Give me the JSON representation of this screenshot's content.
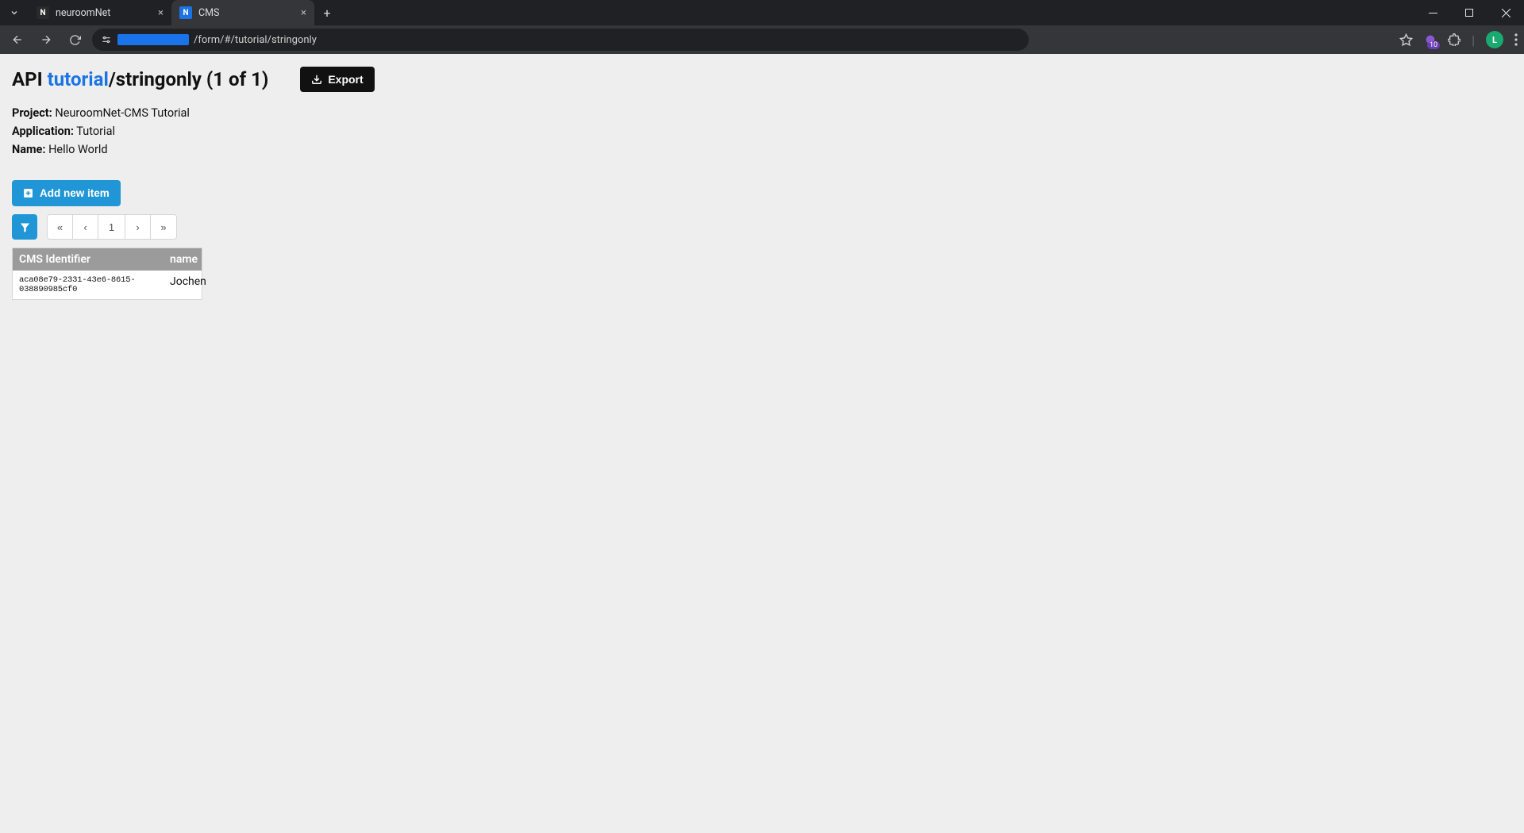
{
  "browser": {
    "tabs": [
      {
        "title": "neuroomNet",
        "active": false
      },
      {
        "title": "CMS",
        "active": true
      }
    ],
    "url_path": "/form/#/tutorial/stringonly",
    "ext_count": "10",
    "avatar_letter": "L"
  },
  "page": {
    "heading_prefix": "API ",
    "heading_link": "tutorial",
    "heading_suffix": "/stringonly (1 of 1)",
    "export_label": "Export",
    "meta": {
      "project_label": "Project:",
      "project_value": "NeuroomNet-CMS Tutorial",
      "application_label": "Application:",
      "application_value": "Tutorial",
      "name_label": "Name:",
      "name_value": "Hello World"
    },
    "add_item_label": "Add new item",
    "pager": {
      "first": "«",
      "prev": "‹",
      "page": "1",
      "next": "›",
      "last": "»"
    },
    "table": {
      "headers": {
        "id": "CMS Identifier",
        "name": "name"
      },
      "rows": [
        {
          "id": "aca08e79-2331-43e6-8615-038890985cf0",
          "name": "Jochen"
        }
      ]
    }
  }
}
